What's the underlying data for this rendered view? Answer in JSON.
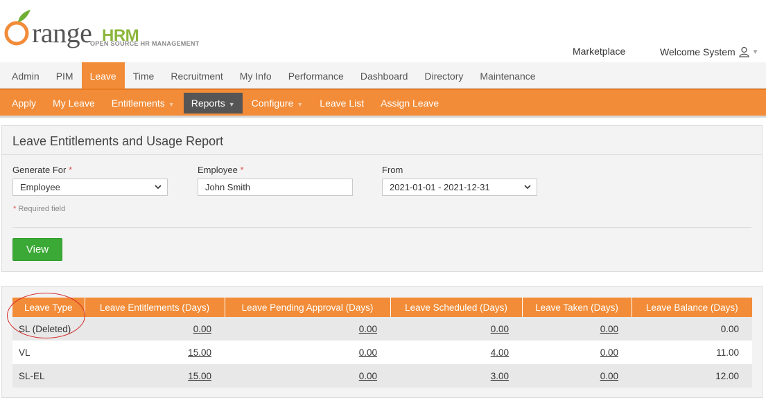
{
  "brand": {
    "word": "range",
    "hrm": "HRM",
    "tagline": "OPEN SOURCE HR MANAGEMENT"
  },
  "header": {
    "marketplace": "Marketplace",
    "welcome": "Welcome System"
  },
  "main_menu": [
    {
      "label": "Admin"
    },
    {
      "label": "PIM"
    },
    {
      "label": "Leave"
    },
    {
      "label": "Time"
    },
    {
      "label": "Recruitment"
    },
    {
      "label": "My Info"
    },
    {
      "label": "Performance"
    },
    {
      "label": "Dashboard"
    },
    {
      "label": "Directory"
    },
    {
      "label": "Maintenance"
    }
  ],
  "sub_menu": [
    {
      "label": "Apply"
    },
    {
      "label": "My Leave"
    },
    {
      "label": "Entitlements"
    },
    {
      "label": "Reports"
    },
    {
      "label": "Configure"
    },
    {
      "label": "Leave List"
    },
    {
      "label": "Assign Leave"
    }
  ],
  "report": {
    "title": "Leave Entitlements and Usage Report",
    "generate_for_label": "Generate For",
    "generate_for_value": "Employee",
    "employee_label": "Employee",
    "employee_value": "John Smith",
    "from_label": "From",
    "from_value": "2021-01-01 - 2021-12-31",
    "required_mark": "*",
    "required_note": "Required field",
    "view_label": "View"
  },
  "table": {
    "headers": [
      "Leave Type",
      "Leave Entitlements (Days)",
      "Leave Pending Approval (Days)",
      "Leave Scheduled (Days)",
      "Leave Taken (Days)",
      "Leave Balance (Days)"
    ],
    "rows": [
      [
        "SL (Deleted)",
        "0.00",
        "0.00",
        "0.00",
        "0.00",
        "0.00"
      ],
      [
        "VL",
        "15.00",
        "0.00",
        "4.00",
        "0.00",
        "11.00"
      ],
      [
        "SL-EL",
        "15.00",
        "0.00",
        "3.00",
        "0.00",
        "12.00"
      ]
    ]
  },
  "colors": {
    "accent": "#f28c38",
    "view_button": "#3aa935",
    "annotation": "#d42a2a"
  }
}
